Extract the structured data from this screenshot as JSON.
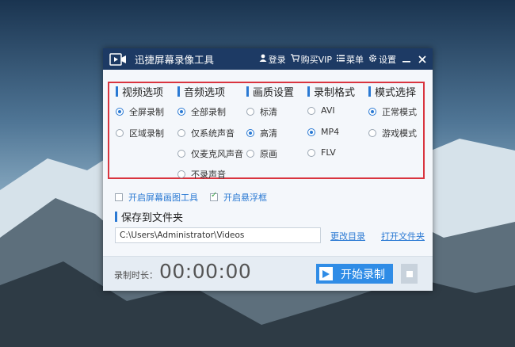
{
  "window": {
    "title": "迅捷屏幕录像工具",
    "login": "登录",
    "buy_vip": "购买VIP",
    "menu": "菜单",
    "settings": "设置"
  },
  "options": {
    "video": {
      "header": "视频选项",
      "items": [
        {
          "label": "全屏录制",
          "selected": true
        },
        {
          "label": "区域录制",
          "selected": false
        }
      ]
    },
    "audio": {
      "header": "音频选项",
      "items": [
        {
          "label": "全部录制",
          "selected": true
        },
        {
          "label": "仅系统声音",
          "selected": false
        },
        {
          "label": "仅麦克风声音",
          "selected": false
        },
        {
          "label": "不录声音",
          "selected": false
        }
      ]
    },
    "quality": {
      "header": "画质设置",
      "items": [
        {
          "label": "标清",
          "selected": false
        },
        {
          "label": "高清",
          "selected": true
        },
        {
          "label": "原画",
          "selected": false
        }
      ]
    },
    "format": {
      "header": "录制格式",
      "items": [
        {
          "label": "AVI",
          "selected": false
        },
        {
          "label": "MP4",
          "selected": true
        },
        {
          "label": "FLV",
          "selected": false
        }
      ]
    },
    "mode": {
      "header": "模式选择",
      "items": [
        {
          "label": "正常模式",
          "selected": true
        },
        {
          "label": "游戏模式",
          "selected": false
        }
      ]
    }
  },
  "checkboxes": {
    "draw_tool": {
      "label": "开启屏幕画图工具",
      "checked": false
    },
    "float_frame": {
      "label": "开启悬浮框",
      "checked": true
    }
  },
  "save": {
    "header": "保存到文件夹",
    "path": "C:\\Users\\Administrator\\Videos",
    "change_dir": "更改目录",
    "open_folder": "打开文件夹"
  },
  "bottom": {
    "duration_label": "录制时长：",
    "duration": "00:00:00",
    "start_label": "开始录制"
  },
  "colors": {
    "accent": "#2a79d3",
    "titlebar": "#1d3a64",
    "highlight_border": "#d9343f"
  }
}
